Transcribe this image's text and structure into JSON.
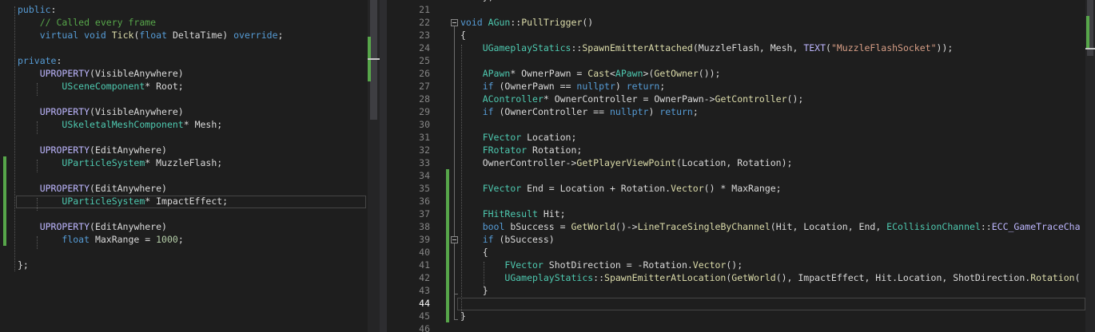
{
  "left_editor": {
    "lines": [
      [
        [
          "kw",
          "public"
        ],
        [
          "tx",
          ":"
        ]
      ],
      [
        [
          "cm",
          "    // Called every frame"
        ]
      ],
      [
        [
          "tx",
          "    "
        ],
        [
          "kw",
          "virtual"
        ],
        [
          "tx",
          " "
        ],
        [
          "kw",
          "void"
        ],
        [
          "tx",
          " "
        ],
        [
          "fn",
          "Tick"
        ],
        [
          "tx",
          "("
        ],
        [
          "kw",
          "float"
        ],
        [
          "tx",
          " DeltaTime) "
        ],
        [
          "kw",
          "override"
        ],
        [
          "tx",
          ";"
        ]
      ],
      [],
      [
        [
          "kw",
          "private"
        ],
        [
          "tx",
          ":"
        ]
      ],
      [
        [
          "tx",
          "    "
        ],
        [
          "mac",
          "UPROPERTY"
        ],
        [
          "tx",
          "(VisibleAnywhere)"
        ]
      ],
      [
        [
          "tx",
          "        "
        ],
        [
          "ty",
          "USceneComponent"
        ],
        [
          "tx",
          "* Root;"
        ]
      ],
      [],
      [
        [
          "tx",
          "    "
        ],
        [
          "mac",
          "UPROPERTY"
        ],
        [
          "tx",
          "(VisibleAnywhere)"
        ]
      ],
      [
        [
          "tx",
          "        "
        ],
        [
          "ty",
          "USkeletalMeshComponent"
        ],
        [
          "tx",
          "* Mesh;"
        ]
      ],
      [],
      [
        [
          "tx",
          "    "
        ],
        [
          "mac",
          "UPROPERTY"
        ],
        [
          "tx",
          "(EditAnywhere)"
        ]
      ],
      [
        [
          "tx",
          "        "
        ],
        [
          "ty",
          "UParticleSystem"
        ],
        [
          "tx",
          "* MuzzleFlash;"
        ]
      ],
      [],
      [
        [
          "tx",
          "    "
        ],
        [
          "mac",
          "UPROPERTY"
        ],
        [
          "tx",
          "(EditAnywhere)"
        ]
      ],
      [
        [
          "tx",
          "        "
        ],
        [
          "ty",
          "UParticleSystem"
        ],
        [
          "tx",
          "* ImpactEffect;"
        ]
      ],
      [],
      [
        [
          "tx",
          "    "
        ],
        [
          "mac",
          "UPROPERTY"
        ],
        [
          "tx",
          "(EditAnywhere)"
        ]
      ],
      [
        [
          "tx",
          "        "
        ],
        [
          "kw",
          "float"
        ],
        [
          "tx",
          " MaxRange = "
        ],
        [
          "nu",
          "1000"
        ],
        [
          "tx",
          ";"
        ]
      ],
      [],
      [
        [
          "tx",
          "};"
        ]
      ]
    ]
  },
  "right_editor": {
    "top_partial": [
      [
        "tx",
        "    };"
      ]
    ],
    "line_numbers": [
      "21",
      "22",
      "23",
      "24",
      "25",
      "26",
      "27",
      "28",
      "29",
      "30",
      "31",
      "32",
      "33",
      "34",
      "35",
      "36",
      "37",
      "38",
      "39",
      "40",
      "41",
      "42",
      "43",
      "44",
      "45",
      "46"
    ],
    "active_line_number": "44",
    "lines": [
      [],
      [
        [
          "kw",
          "void"
        ],
        [
          "tx",
          " "
        ],
        [
          "ty",
          "AGun"
        ],
        [
          "tx",
          "::"
        ],
        [
          "fn",
          "PullTrigger"
        ],
        [
          "tx",
          "()"
        ]
      ],
      [
        [
          "tx",
          "{"
        ]
      ],
      [
        [
          "tx",
          "    "
        ],
        [
          "ty",
          "UGameplayStatics"
        ],
        [
          "tx",
          "::"
        ],
        [
          "fn",
          "SpawnEmitterAttached"
        ],
        [
          "tx",
          "(MuzzleFlash, Mesh, "
        ],
        [
          "mac",
          "TEXT"
        ],
        [
          "tx",
          "("
        ],
        [
          "str",
          "\"MuzzleFlashSocket\""
        ],
        [
          "tx",
          "));"
        ]
      ],
      [],
      [
        [
          "tx",
          "    "
        ],
        [
          "ty",
          "APawn"
        ],
        [
          "tx",
          "* OwnerPawn = "
        ],
        [
          "fn",
          "Cast"
        ],
        [
          "tx",
          "<"
        ],
        [
          "ty",
          "APawn"
        ],
        [
          "tx",
          ">("
        ],
        [
          "fn",
          "GetOwner"
        ],
        [
          "tx",
          "());"
        ]
      ],
      [
        [
          "tx",
          "    "
        ],
        [
          "kw",
          "if"
        ],
        [
          "tx",
          " (OwnerPawn == "
        ],
        [
          "kw",
          "nullptr"
        ],
        [
          "tx",
          ") "
        ],
        [
          "kw",
          "return"
        ],
        [
          "tx",
          ";"
        ]
      ],
      [
        [
          "tx",
          "    "
        ],
        [
          "ty",
          "AController"
        ],
        [
          "tx",
          "* OwnerController = OwnerPawn->"
        ],
        [
          "fn",
          "GetController"
        ],
        [
          "tx",
          "();"
        ]
      ],
      [
        [
          "tx",
          "    "
        ],
        [
          "kw",
          "if"
        ],
        [
          "tx",
          " (OwnerController == "
        ],
        [
          "kw",
          "nullptr"
        ],
        [
          "tx",
          ") "
        ],
        [
          "kw",
          "return"
        ],
        [
          "tx",
          ";"
        ]
      ],
      [],
      [
        [
          "tx",
          "    "
        ],
        [
          "ty",
          "FVector"
        ],
        [
          "tx",
          " Location;"
        ]
      ],
      [
        [
          "tx",
          "    "
        ],
        [
          "ty",
          "FRotator"
        ],
        [
          "tx",
          " Rotation;"
        ]
      ],
      [
        [
          "tx",
          "    OwnerController->"
        ],
        [
          "fn",
          "GetPlayerViewPoint"
        ],
        [
          "tx",
          "(Location, Rotation);"
        ]
      ],
      [],
      [
        [
          "tx",
          "    "
        ],
        [
          "ty",
          "FVector"
        ],
        [
          "tx",
          " End = Location + Rotation."
        ],
        [
          "fn",
          "Vector"
        ],
        [
          "tx",
          "() * MaxRange;"
        ]
      ],
      [],
      [
        [
          "tx",
          "    "
        ],
        [
          "ty",
          "FHitResult"
        ],
        [
          "tx",
          " Hit;"
        ]
      ],
      [
        [
          "tx",
          "    "
        ],
        [
          "kw",
          "bool"
        ],
        [
          "tx",
          " bSuccess = "
        ],
        [
          "fn",
          "GetWorld"
        ],
        [
          "tx",
          "()->"
        ],
        [
          "fn",
          "LineTraceSingleByChannel"
        ],
        [
          "tx",
          "(Hit, Location, End, "
        ],
        [
          "ty",
          "ECollisionChannel"
        ],
        [
          "tx",
          "::"
        ],
        [
          "mac",
          "ECC_GameTraceCha"
        ]
      ],
      [
        [
          "tx",
          "    "
        ],
        [
          "kw",
          "if"
        ],
        [
          "tx",
          " (bSuccess)"
        ]
      ],
      [
        [
          "tx",
          "    {"
        ]
      ],
      [
        [
          "tx",
          "        "
        ],
        [
          "ty",
          "FVector"
        ],
        [
          "tx",
          " ShotDirection = -Rotation."
        ],
        [
          "fn",
          "Vector"
        ],
        [
          "tx",
          "();"
        ]
      ],
      [
        [
          "tx",
          "        "
        ],
        [
          "ty",
          "UGameplayStatics"
        ],
        [
          "tx",
          "::"
        ],
        [
          "fn",
          "SpawnEmitterAtLocation"
        ],
        [
          "tx",
          "("
        ],
        [
          "fn",
          "GetWorld"
        ],
        [
          "tx",
          "(), ImpactEffect, Hit.Location, ShotDirection."
        ],
        [
          "fn",
          "Rotation"
        ],
        [
          "tx",
          "("
        ]
      ],
      [
        [
          "tx",
          "    }"
        ]
      ],
      [],
      [
        [
          "tx",
          "}"
        ]
      ],
      []
    ]
  },
  "colors": {
    "background": "#1e1e1e",
    "keyword": "#569cd6",
    "type": "#4ec9b0",
    "function": "#dcdcaa",
    "comment": "#57a64a",
    "string": "#d69d85",
    "number": "#b5cea8",
    "macro": "#beb7ff",
    "change_bar": "#57a64a"
  },
  "icons": [
    "collapse-toggle-icon"
  ]
}
